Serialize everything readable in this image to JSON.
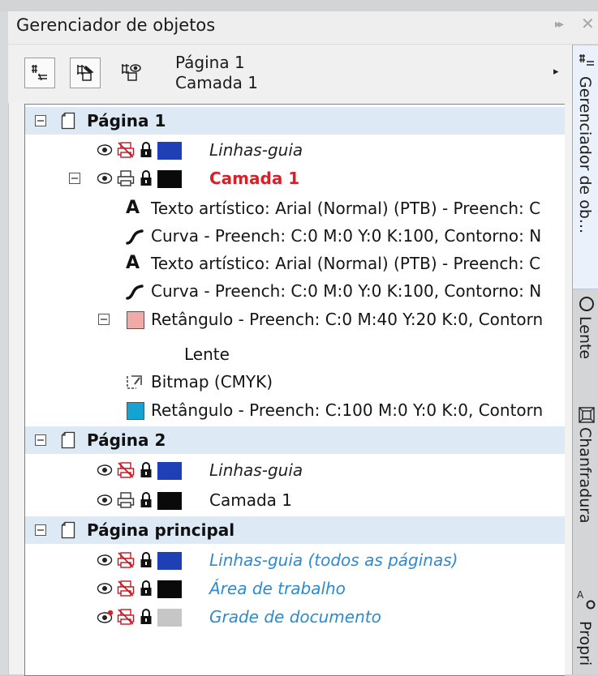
{
  "panel": {
    "title": "Gerenciador de objetos",
    "controls": {
      "collapse": "▸▸",
      "close": "✕"
    }
  },
  "toolbar": {
    "page_label": "Página 1",
    "layer_label": "Camada 1",
    "menu_arrow": "▸",
    "buttons": [
      "properties-icon",
      "edit-across-layers-icon",
      "layer-manager-view-icon"
    ]
  },
  "tree": {
    "page1": {
      "label": "Página 1",
      "guides": "Linhas-guia",
      "layer": "Camada 1",
      "objects": [
        "Texto artístico: Arial (Normal) (PTB) - Preench: C",
        "Curva - Preench: C:0 M:0 Y:0 K:100, Contorno: N",
        "Texto artístico: Arial (Normal) (PTB) - Preench: C",
        "Curva - Preench: C:0 M:0 Y:0 K:100, Contorno: N",
        "Retângulo - Preench: C:0 M:40 Y:20 K:0, Contorn",
        "Lente",
        "Bitmap (CMYK)",
        "Retângulo - Preench: C:100 M:0 Y:0 K:0, Contorn"
      ]
    },
    "page2": {
      "label": "Página 2",
      "guides": "Linhas-guia",
      "layer": "Camada 1"
    },
    "master": {
      "label": "Página principal",
      "guides": "Linhas-guia (todos as páginas)",
      "desktop": "Área de trabalho",
      "grid": "Grade de documento"
    }
  },
  "side_tabs": [
    {
      "label": "Gerenciador de ob...",
      "icon": "object-manager-icon",
      "active": true
    },
    {
      "label": "Lente",
      "icon": "lens-icon",
      "active": false
    },
    {
      "label": "Chanfradura",
      "icon": "bevel-icon",
      "active": false
    },
    {
      "label": "Propri",
      "icon": "properties-tab-icon",
      "active": false
    }
  ],
  "colors": {
    "guides_swatch": "#1f3fb5",
    "layer_swatch": "#0a0a0a",
    "pink_swatch": "#f2aaa6",
    "cyan_swatch": "#14a4d4",
    "grid_swatch": "#c6c6c6",
    "active_layer_text": "#d6202a",
    "master_text": "#2d8ad2",
    "header_row": "#dde9f4"
  }
}
